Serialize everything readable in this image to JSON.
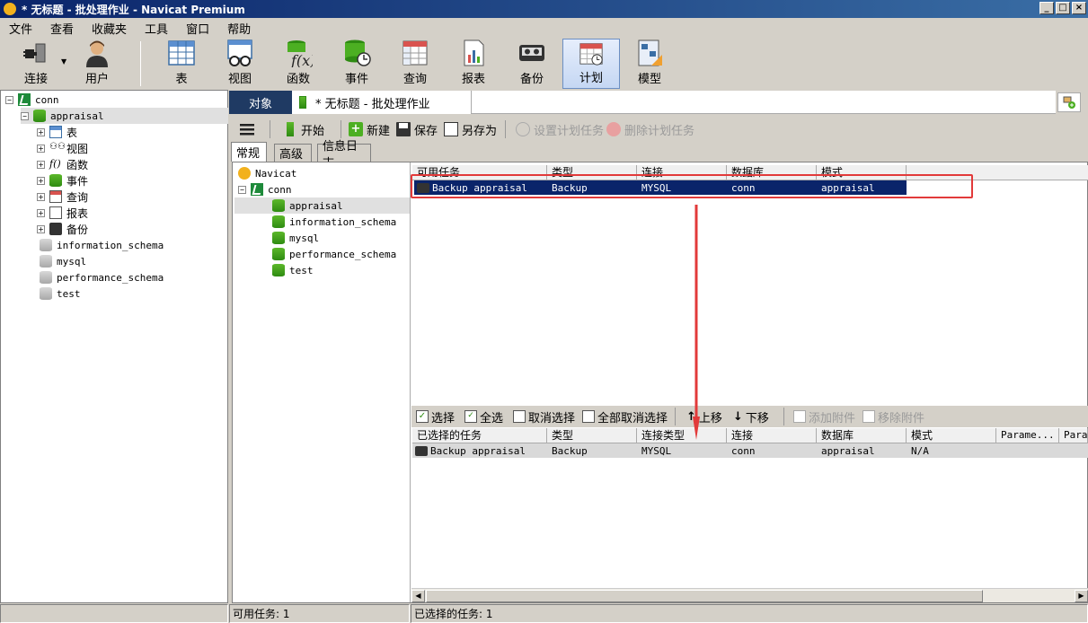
{
  "window": {
    "title": "* 无标题 - 批处理作业 - Navicat Premium",
    "controls": [
      "_",
      "□",
      "×"
    ]
  },
  "menu": [
    "文件",
    "查看",
    "收藏夹",
    "工具",
    "窗口",
    "帮助"
  ],
  "toolbar": {
    "connect": "连接",
    "user": "用户",
    "table": "表",
    "view": "视图",
    "function": "函数",
    "event": "事件",
    "query": "查询",
    "report": "报表",
    "backup": "备份",
    "schedule": "计划",
    "model": "模型"
  },
  "left_tree": {
    "connection": "conn",
    "database": "appraisal",
    "children": [
      "表",
      "视图",
      "函数",
      "事件",
      "查询",
      "报表",
      "备份"
    ],
    "other_dbs": [
      "information_schema",
      "mysql",
      "performance_schema",
      "test"
    ]
  },
  "tabs": {
    "objects": "对象",
    "document": "* 无标题 - 批处理作业"
  },
  "actions": {
    "start": "开始",
    "new": "新建",
    "save": "保存",
    "save_as": "另存为",
    "set_task": "设置计划任务",
    "delete_task": "删除计划任务"
  },
  "subtabs": [
    "常规",
    "高级",
    "信息日志"
  ],
  "inner_tree": {
    "root": "Navicat",
    "connection": "conn",
    "databases": [
      "appraisal",
      "information_schema",
      "mysql",
      "performance_schema",
      "test"
    ]
  },
  "available_grid": {
    "headers": [
      "可用任务",
      "类型",
      "连接",
      "数据库",
      "模式"
    ],
    "rows": [
      [
        "Backup appraisal",
        "Backup",
        "MYSQL",
        "conn",
        "appraisal"
      ]
    ]
  },
  "mid_toolbar": {
    "select": "选择",
    "select_all": "全选",
    "deselect": "取消选择",
    "deselect_all": "全部取消选择",
    "move_up": "上移",
    "move_down": "下移",
    "add_attachment": "添加附件",
    "remove_attachment": "移除附件"
  },
  "selected_grid": {
    "headers": [
      "已选择的任务",
      "类型",
      "连接类型",
      "连接",
      "数据库",
      "模式",
      "Parame...",
      "Param"
    ],
    "rows": [
      [
        "Backup appraisal",
        "Backup",
        "MYSQL",
        "conn",
        "appraisal",
        "N/A",
        "",
        ""
      ]
    ]
  },
  "status": {
    "available": "可用任务: 1",
    "selected": "已选择的任务: 1"
  },
  "colors": {
    "accent_navy": "#0a246a",
    "annotation_red": "#e23a3a",
    "db_green": "#2e8b12"
  }
}
